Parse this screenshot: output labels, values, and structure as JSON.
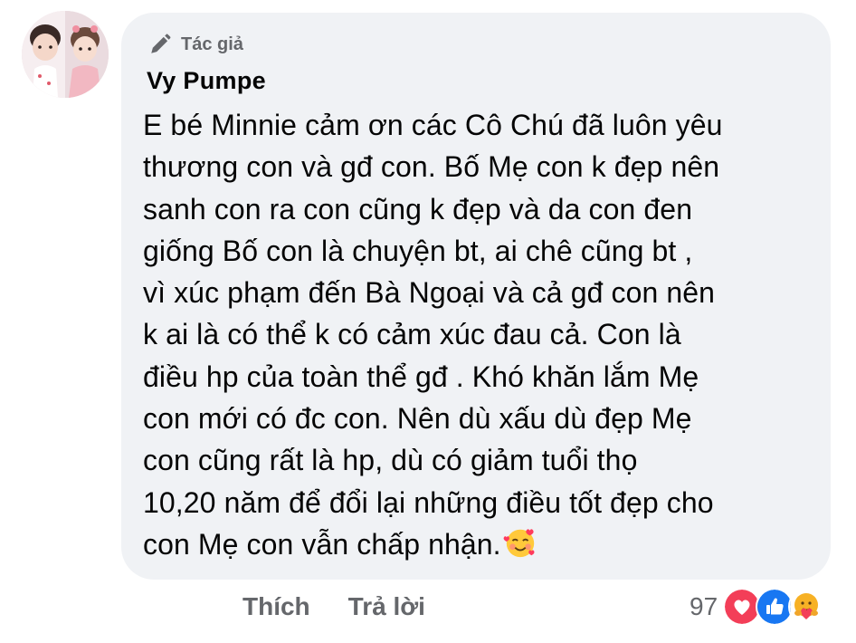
{
  "comment": {
    "badge_label": "Tác giả",
    "badge_icon": "pen-icon",
    "author": "Vy Pumpe",
    "text_lines": [
      "E bé Minnie cảm ơn các Cô Chú đã luôn yêu",
      "thương con và gđ con. Bố Mẹ con k đẹp nên",
      "sanh con ra con cũng k đẹp và da con đen",
      "giống Bố con là chuyện bt, ai chê cũng bt ,",
      "vì xúc phạm đến Bà Ngoại và cả gđ con nên",
      "k ai là có thể k có cảm xúc đau cả. Con là",
      "điều hp của toàn thể gđ . Khó khăn lắm Mẹ",
      "con mới có đc con. Nên dù xấu dù đẹp Mẹ",
      "con cũng rất là hp, dù có giảm tuổi thọ",
      "10,20 năm để đổi lại những điều tốt đẹp cho",
      "con Mẹ con vẫn chấp nhận."
    ],
    "trailing_emoji": "smiling-face-with-hearts-emoji"
  },
  "actions": {
    "like_label": "Thích",
    "reply_label": "Trả lời"
  },
  "reactions": {
    "count": "97",
    "icons": [
      "love-reaction-icon",
      "like-reaction-icon",
      "care-reaction-icon"
    ]
  },
  "colors": {
    "bubble_bg": "#f0f2f5",
    "secondary_text": "#65676b",
    "primary_text": "#050505",
    "love_red": "#f33e58",
    "like_blue": "#1877f2",
    "care_yellow": "#f7b125"
  }
}
